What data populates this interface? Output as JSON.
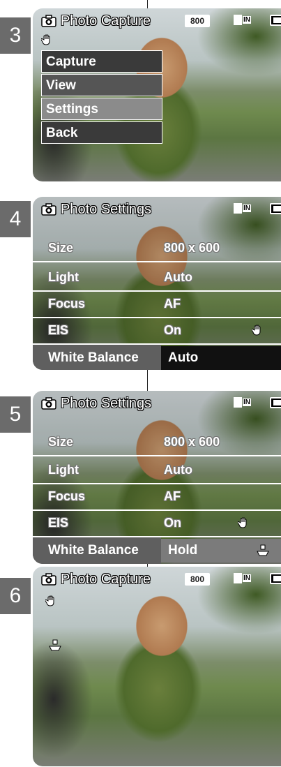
{
  "panels": [
    {
      "step": "3",
      "header": {
        "title": "Photo Capture",
        "resolution_badge": "800",
        "memory_label": "IN"
      },
      "menu": [
        "Capture",
        "View",
        "Settings",
        "Back"
      ]
    },
    {
      "step": "4",
      "header": {
        "title": "Photo Settings",
        "memory_label": "IN"
      },
      "settings": [
        {
          "label": "Size",
          "value": "800 x 600"
        },
        {
          "label": "Light",
          "value": "Auto"
        },
        {
          "label": "Focus",
          "value": "AF"
        },
        {
          "label": "EIS",
          "value": "On"
        }
      ],
      "white_balance": {
        "label": "White Balance",
        "value": "Auto"
      }
    },
    {
      "step": "5",
      "header": {
        "title": "Photo Settings",
        "memory_label": "IN"
      },
      "settings": [
        {
          "label": "Size",
          "value": "800 x 600"
        },
        {
          "label": "Light",
          "value": "Auto"
        },
        {
          "label": "Focus",
          "value": "AF"
        },
        {
          "label": "EIS",
          "value": "On"
        }
      ],
      "white_balance": {
        "label": "White Balance",
        "value": "Hold"
      }
    },
    {
      "step": "6",
      "header": {
        "title": "Photo Capture",
        "resolution_badge": "800",
        "memory_label": "IN"
      }
    }
  ],
  "icons": [
    "camera-icon",
    "eis-hand-icon",
    "battery-icon",
    "memory-icon",
    "white-balance-hold-icon"
  ],
  "colors": {
    "step_badge": "#6b6b6b",
    "menu_highlight": "#8b8b8b",
    "menu_item": "#3a3a3a"
  }
}
